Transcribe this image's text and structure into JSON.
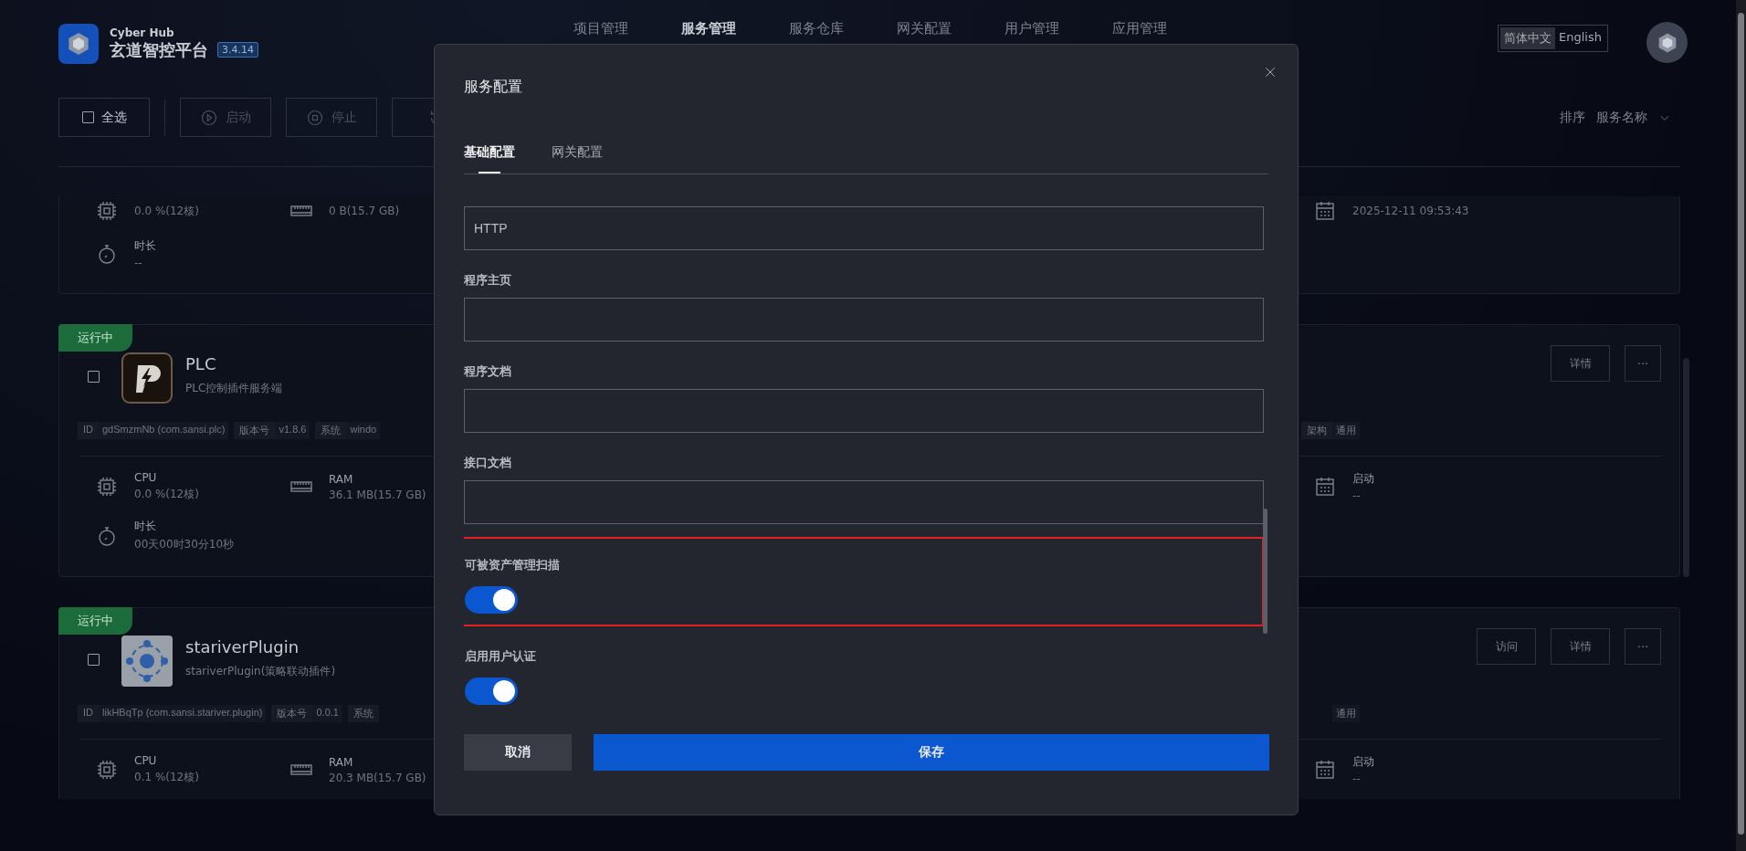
{
  "app": {
    "brand": "Cyber Hub",
    "title": "玄道智控平台",
    "version": "3.4.14"
  },
  "nav": [
    {
      "label": "项目管理",
      "selected": false
    },
    {
      "label": "服务管理",
      "selected": true
    },
    {
      "label": "服务仓库",
      "selected": false
    },
    {
      "label": "网关配置",
      "selected": false
    },
    {
      "label": "用户管理",
      "selected": false
    },
    {
      "label": "应用管理",
      "selected": false
    }
  ],
  "language": [
    {
      "label": "简体中文",
      "selected": true
    },
    {
      "label": "English",
      "selected": false
    }
  ],
  "toolbar": {
    "select_all": {
      "label": "全选",
      "checked": false
    },
    "actions": [
      {
        "kind": "play",
        "label": "启动",
        "disabled": true
      },
      {
        "kind": "stop",
        "label": "停止",
        "disabled": true
      },
      {
        "kind": "restart",
        "disabled": true
      }
    ]
  },
  "sort": {
    "label": "排序",
    "value": "服务名称"
  },
  "services": [
    {
      "metrics": [
        {
          "kind": "cpu",
          "value": "0.0 %(12核)"
        },
        {
          "kind": "ram",
          "value": "0 B(15.7 GB)"
        },
        {
          "kind": "start",
          "value": "2025-12-11 09:53:43"
        },
        {
          "kind": "duration",
          "label": "时长",
          "value": "--"
        }
      ]
    },
    {
      "status": "运行中",
      "checked": false,
      "name": "PLC",
      "description": "PLC控制插件服务端",
      "tags": [
        {
          "label": "ID",
          "value": "gdSmzmNb (com.sansi.plc)"
        },
        {
          "label": "版本号",
          "value": "v1.8.6"
        },
        {
          "label": "系统",
          "value": "windo"
        }
      ],
      "right_tags": [
        {
          "label": "架构",
          "value": "通用"
        }
      ],
      "actions": [
        {
          "kind": "text",
          "label": "详情"
        },
        {
          "kind": "more",
          "label": "···"
        }
      ],
      "metrics": [
        {
          "kind": "cpu",
          "label": "CPU",
          "value": "0.0 %(12核)"
        },
        {
          "kind": "ram",
          "label": "RAM",
          "value": "36.1 MB(15.7 GB)"
        },
        {
          "kind": "start",
          "label": "启动",
          "value": "--"
        },
        {
          "kind": "duration",
          "label": "时长",
          "value": "00天00时30分10秒"
        }
      ]
    },
    {
      "status": "运行中",
      "checked": false,
      "name": "stariverPlugin",
      "description": "stariverPlugin(策略联动插件)",
      "tags": [
        {
          "label": "ID",
          "value": "likHBqTp (com.sansi.stariver.plugin)"
        },
        {
          "label": "版本号",
          "value": "0.0.1"
        },
        {
          "label": "系统"
        }
      ],
      "right_tags": [
        {
          "value": "通用"
        }
      ],
      "actions": [
        {
          "kind": "text",
          "label": "访问"
        },
        {
          "kind": "text",
          "label": "详情"
        },
        {
          "kind": "more",
          "label": "···"
        }
      ],
      "metrics": [
        {
          "kind": "cpu",
          "label": "CPU",
          "value": "0.1 %(12核)"
        },
        {
          "kind": "ram",
          "label": "RAM",
          "value": "20.3 MB(15.7 GB)"
        },
        {
          "kind": "start",
          "label": "启动",
          "value": "--"
        }
      ]
    }
  ],
  "dialog": {
    "title": "服务配置",
    "tabs": [
      {
        "label": "基础配置",
        "selected": true
      },
      {
        "label": "网关配置",
        "selected": false
      }
    ],
    "fields": [
      {
        "kind": "input",
        "value": "HTTP"
      },
      {
        "kind": "input",
        "label": "程序主页"
      },
      {
        "kind": "input",
        "label": "程序文档"
      },
      {
        "kind": "input",
        "label": "接口文档"
      },
      {
        "kind": "switch",
        "label": "可被资产管理扫描",
        "on": true,
        "highlighted": true
      },
      {
        "kind": "switch",
        "label": "启用用户认证",
        "on": true,
        "highlighted": false
      }
    ],
    "buttons": [
      {
        "kind": "secondary",
        "label": "取消"
      },
      {
        "kind": "primary",
        "label": "保存"
      }
    ]
  }
}
